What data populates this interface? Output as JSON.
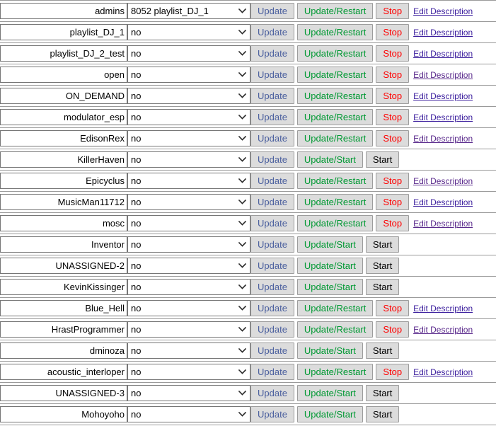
{
  "table": {
    "columns": [
      "mount-name",
      "source-select",
      "actions"
    ],
    "labels": {
      "update": "Update",
      "update_restart": "Update/Restart",
      "update_start": "Update/Start",
      "stop": "Stop",
      "start": "Start",
      "edit_description": "Edit Description"
    },
    "colors": {
      "update": "#4a5f9e",
      "update_go": "#009933",
      "stop": "#ff0000",
      "start": "#000000",
      "link": "#3c1f9e",
      "link_visited": "#5a2a8c",
      "button_face": "#dcdcdc",
      "border": "#9a9a9a"
    },
    "rows": [
      {
        "name": "admins",
        "select_value": "8052 playlist_DJ_1",
        "running": true,
        "link_visited": false
      },
      {
        "name": "playlist_DJ_1",
        "select_value": "no",
        "running": true,
        "link_visited": false
      },
      {
        "name": "playlist_DJ_2_test",
        "select_value": "no",
        "running": true,
        "link_visited": false
      },
      {
        "name": "open",
        "select_value": "no",
        "running": true,
        "link_visited": true
      },
      {
        "name": "ON_DEMAND",
        "select_value": "no",
        "running": true,
        "link_visited": false
      },
      {
        "name": "modulator_esp",
        "select_value": "no",
        "running": true,
        "link_visited": false
      },
      {
        "name": "EdisonRex",
        "select_value": "no",
        "running": true,
        "link_visited": true
      },
      {
        "name": "KillerHaven",
        "select_value": "no",
        "running": false,
        "link_visited": false
      },
      {
        "name": "Epicyclus",
        "select_value": "no",
        "running": true,
        "link_visited": true
      },
      {
        "name": "MusicMan11712",
        "select_value": "no",
        "running": true,
        "link_visited": false
      },
      {
        "name": "mosc",
        "select_value": "no",
        "running": true,
        "link_visited": true
      },
      {
        "name": "Inventor",
        "select_value": "no",
        "running": false,
        "link_visited": false
      },
      {
        "name": "UNASSIGNED-2",
        "select_value": "no",
        "running": false,
        "link_visited": false
      },
      {
        "name": "KevinKissinger",
        "select_value": "no",
        "running": false,
        "link_visited": false
      },
      {
        "name": "Blue_Hell",
        "select_value": "no",
        "running": true,
        "link_visited": false
      },
      {
        "name": "HrastProgrammer",
        "select_value": "no",
        "running": true,
        "link_visited": true
      },
      {
        "name": "dminoza",
        "select_value": "no",
        "running": false,
        "link_visited": false
      },
      {
        "name": "acoustic_interloper",
        "select_value": "no",
        "running": true,
        "link_visited": false
      },
      {
        "name": "UNASSIGNED-3",
        "select_value": "no",
        "running": false,
        "link_visited": false
      },
      {
        "name": "Mohoyoho",
        "select_value": "no",
        "running": false,
        "link_visited": false
      }
    ],
    "select_options": [
      "no",
      "8052 playlist_DJ_1"
    ]
  }
}
